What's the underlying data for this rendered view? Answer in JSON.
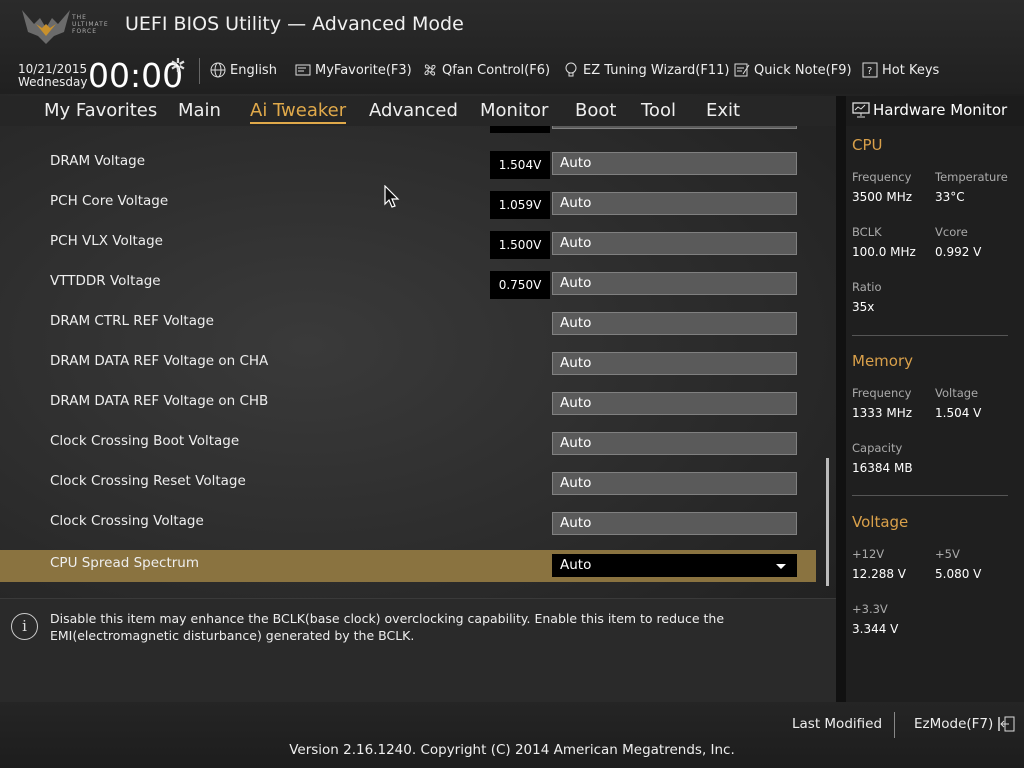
{
  "header": {
    "logo_text": "THE ULTIMATE FORCE",
    "title": "UEFI BIOS Utility — Advanced Mode",
    "date": "10/21/2015",
    "day": "Wednesday",
    "time": "00:00",
    "tools": {
      "language": "English",
      "favorite": "MyFavorite(F3)",
      "qfan": "Qfan Control(F6)",
      "eztuning": "EZ Tuning Wizard(F11)",
      "quicknote": "Quick Note(F9)",
      "hotkeys": "Hot Keys"
    }
  },
  "nav": {
    "tabs": [
      "My Favorites",
      "Main",
      "Ai Tweaker",
      "Advanced",
      "Monitor",
      "Boot",
      "Tool",
      "Exit"
    ],
    "active": "Ai Tweaker"
  },
  "settings": [
    {
      "label": "DRAM Voltage",
      "value": "1.504V",
      "field": "Auto"
    },
    {
      "label": "PCH Core Voltage",
      "value": "1.059V",
      "field": "Auto"
    },
    {
      "label": "PCH VLX Voltage",
      "value": "1.500V",
      "field": "Auto"
    },
    {
      "label": "VTTDDR Voltage",
      "value": "0.750V",
      "field": "Auto"
    },
    {
      "label": "DRAM CTRL REF Voltage",
      "field": "Auto"
    },
    {
      "label": "DRAM DATA REF Voltage on CHA",
      "field": "Auto"
    },
    {
      "label": "DRAM DATA REF Voltage on CHB",
      "field": "Auto"
    },
    {
      "label": "Clock Crossing Boot Voltage",
      "field": "Auto"
    },
    {
      "label": "Clock Crossing Reset Voltage",
      "field": "Auto"
    },
    {
      "label": "Clock Crossing Voltage",
      "field": "Auto"
    },
    {
      "label": "CPU Spread Spectrum",
      "field": "Auto",
      "selected": true
    }
  ],
  "help": "Disable this item may enhance the BCLK(base clock) overclocking capability. Enable this item to reduce the EMI(electromagnetic disturbance) generated by the BCLK.",
  "monitor": {
    "title": "Hardware Monitor",
    "cpu": {
      "title": "CPU",
      "freq_label": "Frequency",
      "freq": "3500 MHz",
      "temp_label": "Temperature",
      "temp": "33°C",
      "bclk_label": "BCLK",
      "bclk": "100.0 MHz",
      "vcore_label": "Vcore",
      "vcore": "0.992 V",
      "ratio_label": "Ratio",
      "ratio": "35x"
    },
    "memory": {
      "title": "Memory",
      "freq_label": "Frequency",
      "freq": "1333 MHz",
      "volt_label": "Voltage",
      "volt": "1.504 V",
      "cap_label": "Capacity",
      "cap": "16384 MB"
    },
    "voltage": {
      "title": "Voltage",
      "v12_label": "+12V",
      "v12": "12.288 V",
      "v5_label": "+5V",
      "v5": "5.080 V",
      "v33_label": "+3.3V",
      "v33": "3.344 V"
    }
  },
  "footer": {
    "last_modified": "Last Modified",
    "ezmode": "EzMode(F7)",
    "version": "Version 2.16.1240. Copyright (C) 2014 American Megatrends, Inc."
  },
  "colors": {
    "accent": "#e0a94a",
    "selected_row": "#8a7340"
  }
}
